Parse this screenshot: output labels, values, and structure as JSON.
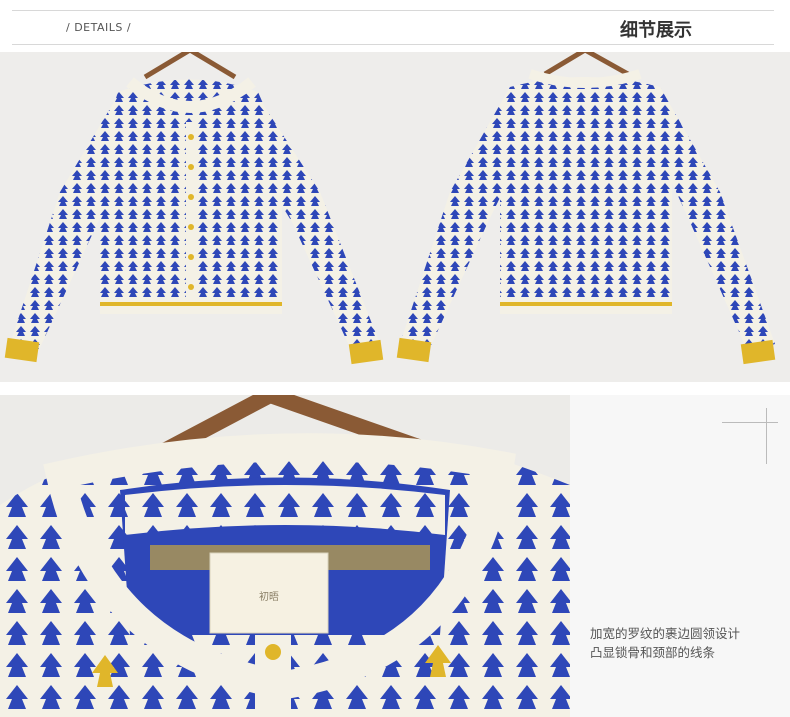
{
  "header": {
    "details_label": "/ DETAILS /",
    "title_cn": "细节展示"
  },
  "detail": {
    "label_tag_text": "初晤",
    "description_line1": "加宽的罗纹的裹边圆领设计",
    "description_line2": "凸显锁骨和颈部的线条"
  },
  "colors": {
    "knit_blue": "#2e47b8",
    "knit_cream": "#f4f1e6",
    "trim_yellow": "#e0b62a",
    "wood_hanger": "#8a5a35",
    "background": "#eeedeb"
  },
  "icons": {
    "crosshair": "crosshair-icon"
  }
}
